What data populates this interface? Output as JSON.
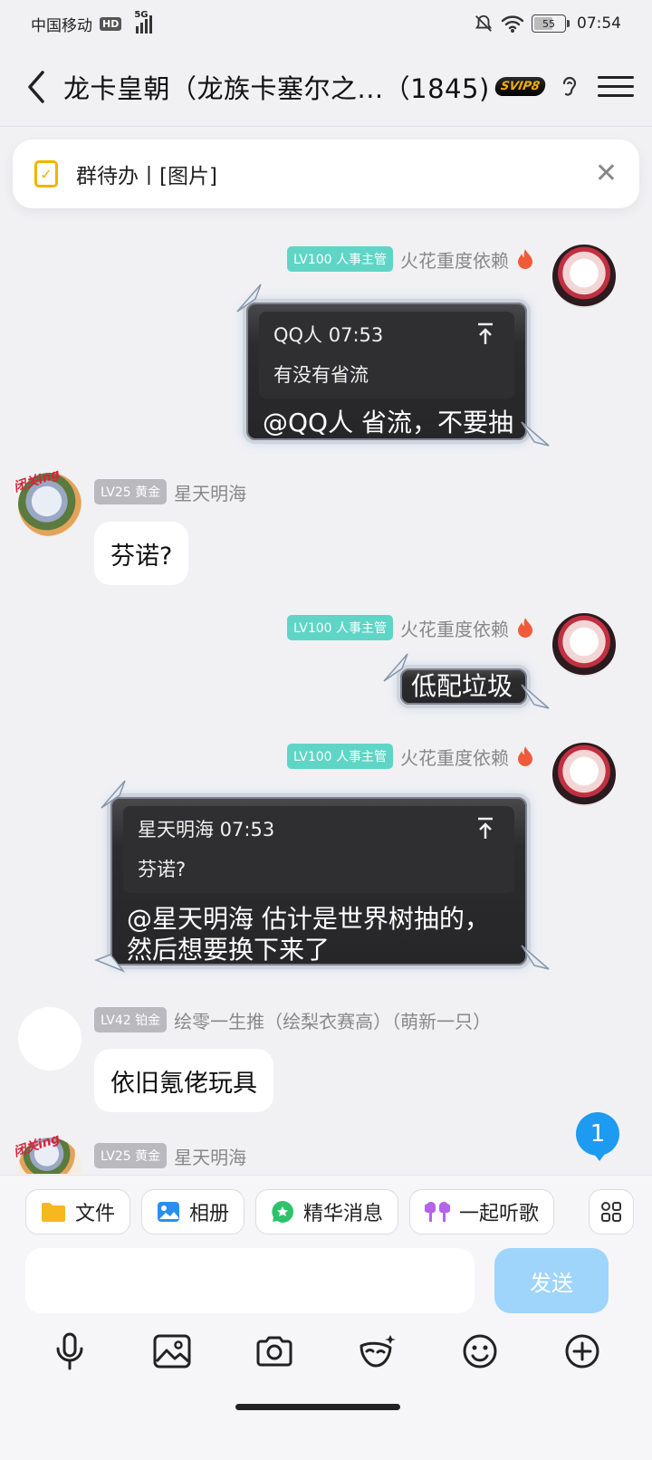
{
  "status_bar": {
    "carrier": "中国移动",
    "hd": "HD",
    "network": "5G",
    "battery": "55",
    "time": "07:54"
  },
  "header": {
    "title": "龙卡皇朝（龙族卡塞尔之...（1845)",
    "vip_badge": "SVIP8"
  },
  "todo": {
    "text": "群待办丨[图片]"
  },
  "messages": [
    {
      "level": "LV100 人事主管",
      "nick": "火花重度依赖",
      "quote_author_time": "QQ人 07:53",
      "quote_text": "有没有省流",
      "text": "@QQ人 省流，不要抽"
    },
    {
      "level": "LV25 黄金",
      "nick": "星天明海",
      "avatar_tag": "闭关ing",
      "text": "芬诺?"
    },
    {
      "level": "LV100 人事主管",
      "nick": "火花重度依赖",
      "text": "低配垃圾"
    },
    {
      "level": "LV100 人事主管",
      "nick": "火花重度依赖",
      "quote_author_time": "星天明海 07:53",
      "quote_text": "芬诺?",
      "text_line1": "@星天明海 估计是世界树抽的，",
      "text_line2": "然后想要换下来了"
    },
    {
      "level": "LV42 铂金",
      "nick": "绘零一生推（绘梨衣赛高）（萌新一只）",
      "text": "依旧氪佬玩具"
    },
    {
      "level": "LV25 黄金",
      "nick": "星天明海",
      "avatar_tag": "闭关ing"
    }
  ],
  "unread_count": "1",
  "quick_actions": [
    {
      "label": "文件",
      "icon": "folder-icon",
      "color": "#f6b81e"
    },
    {
      "label": "相册",
      "icon": "photo-icon",
      "color": "#2a8ff0"
    },
    {
      "label": "精华消息",
      "icon": "star-icon",
      "color": "#2dc26b"
    },
    {
      "label": "一起听歌",
      "icon": "earbuds-icon",
      "color": "#b464e8"
    }
  ],
  "input": {
    "value": "",
    "send_label": "发送"
  },
  "toolbar": [
    "mic-icon",
    "image-icon",
    "camera-icon",
    "emoji-mask-icon",
    "smile-icon",
    "plus-circle-icon"
  ]
}
